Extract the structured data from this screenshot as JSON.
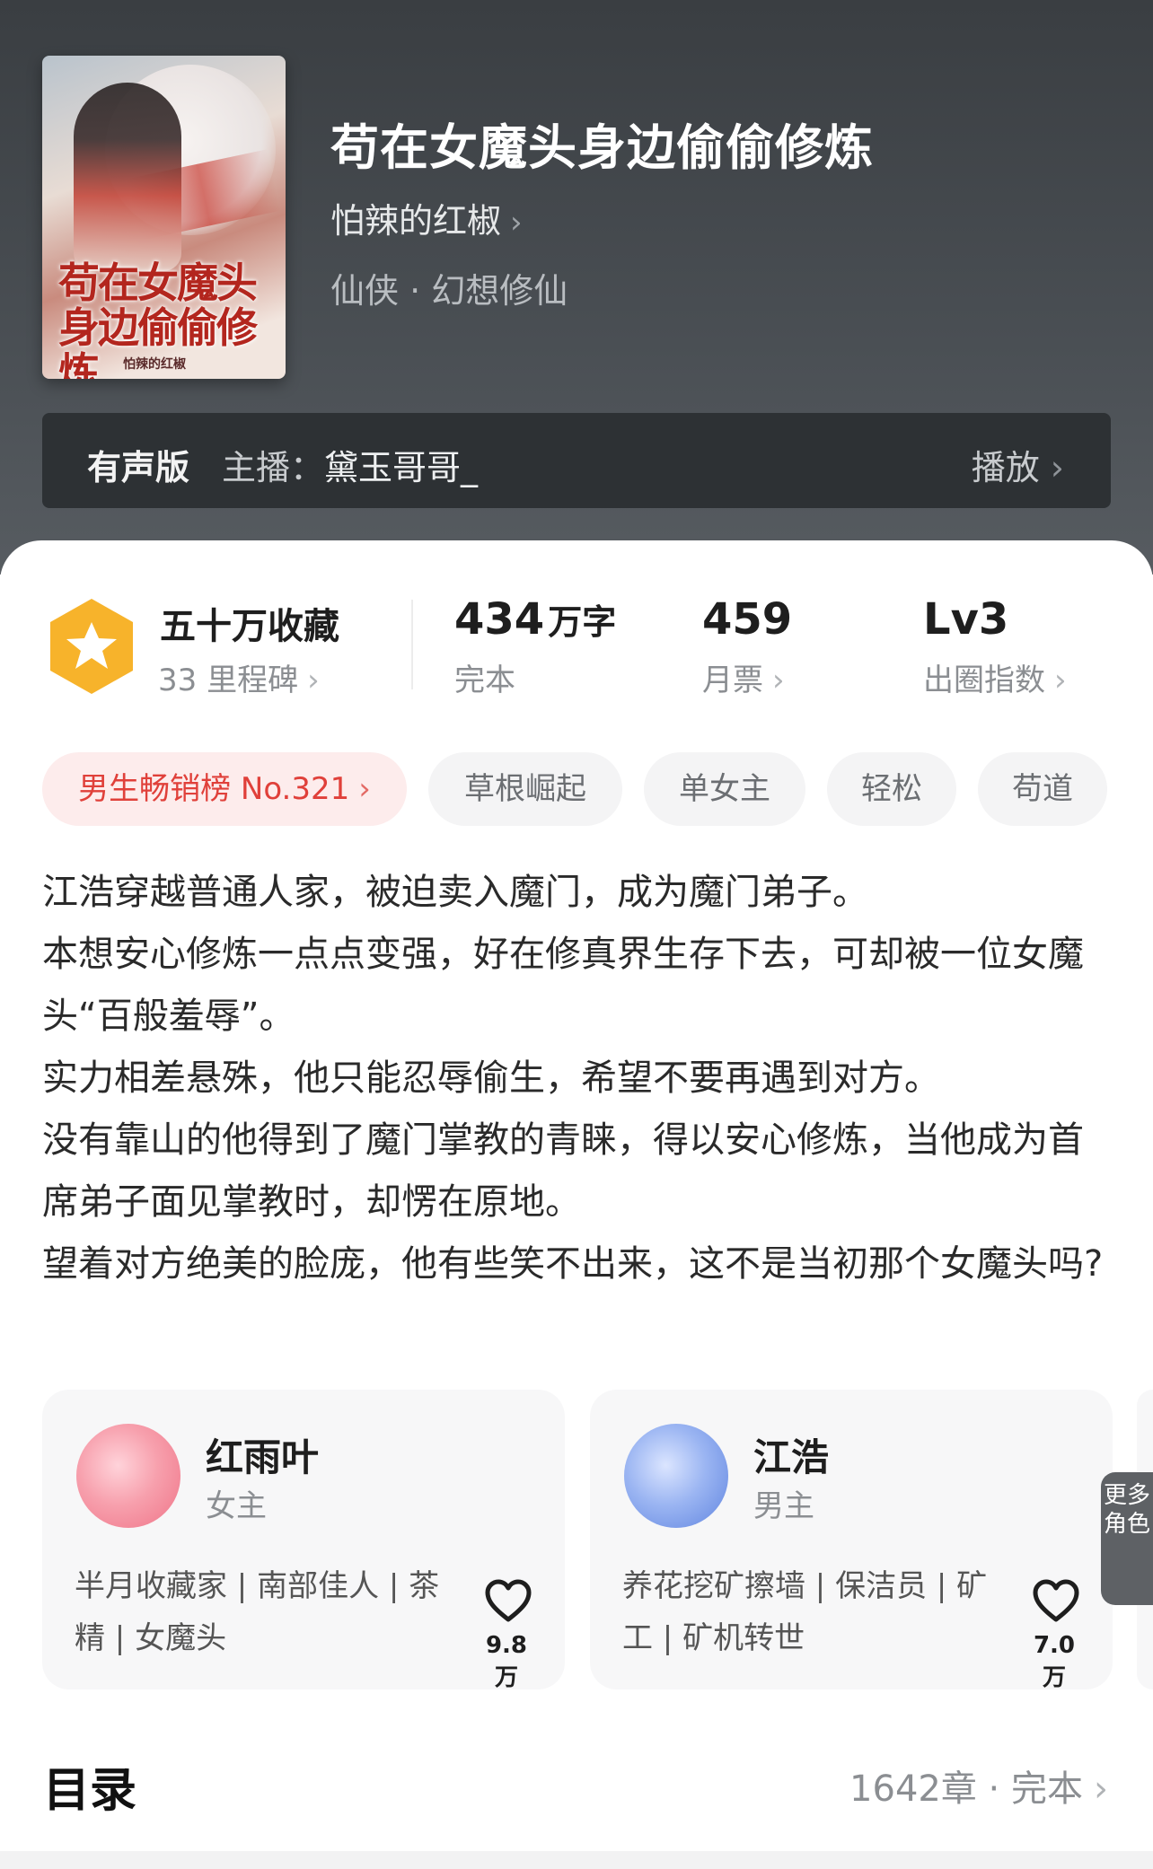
{
  "book": {
    "title": "苟在女魔头身边偷偷修炼",
    "author": "怕辣的红椒",
    "genre": "仙侠 · 幻想修仙",
    "cover_title": "苟在女魔头身边偷偷修炼",
    "cover_author": "怕辣的红椒"
  },
  "audio": {
    "label": "有声版",
    "host_prefix": "主播：",
    "host_name": "黛玉哥哥_",
    "play_label": "播放"
  },
  "stats": {
    "collection_title": "五十万收藏",
    "milestone": "33 里程碑",
    "word_count": "434",
    "word_unit": "万字",
    "status": "完本",
    "monthly_tickets": "459",
    "monthly_label": "月票",
    "level": "Lv3",
    "level_label": "出圈指数"
  },
  "tags": [
    "男生畅销榜 No.321",
    "草根崛起",
    "单女主",
    "轻松",
    "苟道"
  ],
  "description": [
    "江浩穿越普通人家，被迫卖入魔门，成为魔门弟子。",
    "本想安心修炼一点点变强，好在修真界生存下去，可却被一位女魔头“百般羞辱”。",
    "实力相差悬殊，他只能忍辱偷生，希望不要再遇到对方。",
    "没有靠山的他得到了魔门掌教的青睐，得以安心修炼，当他成为首席弟子面见掌教时，却愣在原地。",
    "望着对方绝美的脸庞，他有些笑不出来，这不是当初那个女魔头吗?"
  ],
  "characters": [
    {
      "name": "红雨叶",
      "role": "女主",
      "traits": "半月收藏家 | 南部佳人 | 茶精 | 女魔头",
      "likes": "9.8万",
      "color": "#f07a8a"
    },
    {
      "name": "江浩",
      "role": "男主",
      "traits": "养花挖矿擦墙 | 保洁员 | 矿工 | 矿机转世",
      "likes": "7.0万",
      "color": "#6b8fe6"
    }
  ],
  "more_roles": "更多角色",
  "toc": {
    "title": "目录",
    "chapters": "1642章",
    "status": "完本"
  },
  "colors": {
    "accent_red": "#e0403a",
    "badge_orange": "#f7b32b",
    "header_bg": "#41464a"
  }
}
